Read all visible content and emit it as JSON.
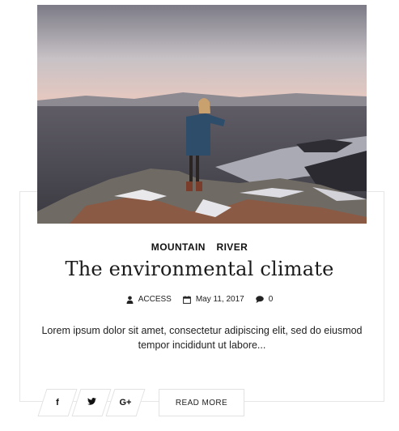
{
  "post": {
    "categories": [
      "MOUNTAIN",
      "RIVER"
    ],
    "title": "The environmental climate",
    "meta": {
      "author": "ACCESS",
      "date": "May 11, 2017",
      "comments": "0"
    },
    "excerpt": "Lorem ipsum dolor sit amet, consectetur adipiscing elit, sed do eiusmod tempor incididunt ut labore..."
  },
  "share": {
    "facebook": "f",
    "twitter": "🐦",
    "google_plus": "G+"
  },
  "read_more_label": "READ MORE",
  "icons": {
    "author": "user-icon",
    "date": "calendar-icon",
    "comments": "comment-icon"
  }
}
